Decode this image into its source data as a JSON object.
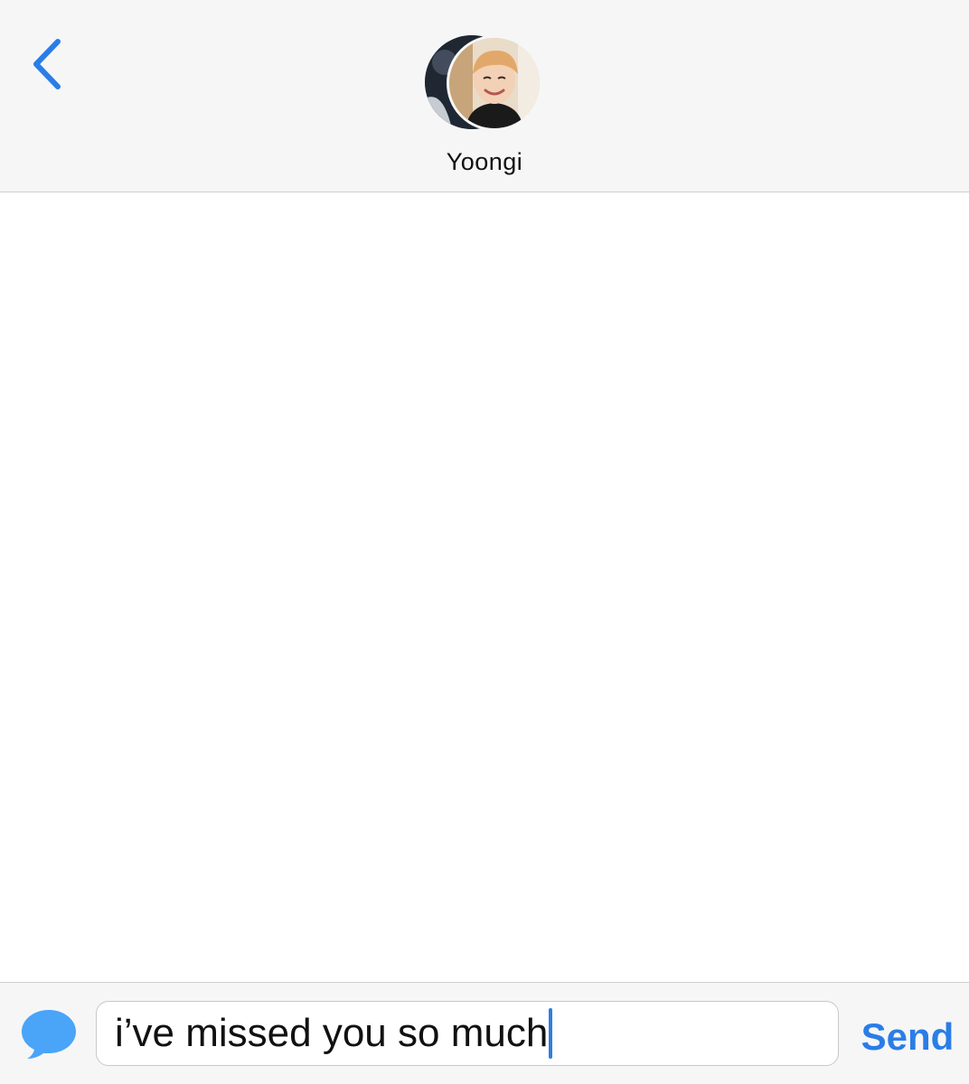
{
  "header": {
    "back_icon": "chevron-left-icon",
    "contact_name": "Yoongi",
    "accent_color": "#2a7de8"
  },
  "composer": {
    "app_icon": "imessage-bubble-icon",
    "text_value": "i’ve missed you so much",
    "send_label": "Send"
  },
  "colors": {
    "header_bg": "#f6f6f6",
    "message_bg": "#ffffff",
    "caret": "#2f7de1",
    "bubble_icon": "#4aa4f8"
  }
}
